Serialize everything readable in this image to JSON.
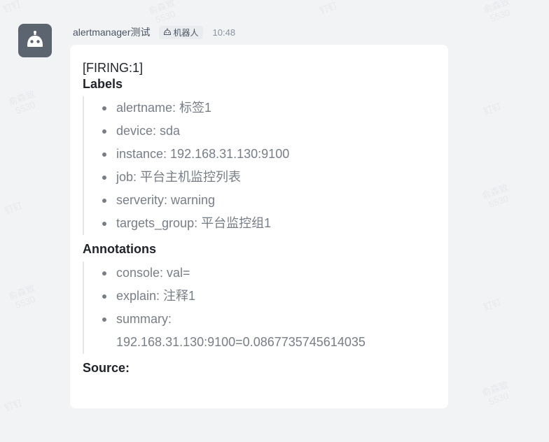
{
  "watermark": {
    "lines": [
      "钉钉",
      "俞森致",
      "5530"
    ]
  },
  "icons": {
    "avatar": "robot-icon",
    "bot_tag": "robot-icon"
  },
  "colors": {
    "background": "#f2f3f5",
    "card": "#ffffff",
    "avatar_bg": "#5c6470",
    "item_text": "#787e87"
  },
  "header": {
    "sender": "alertmanager测试",
    "bot_tag": "机器人",
    "time": "10:48"
  },
  "message": {
    "firing": "[FIRING:1]",
    "labels_title": "Labels",
    "labels": [
      "alertname: 标签1",
      "device: sda",
      "instance: 192.168.31.130:9100",
      "job: 平台主机监控列表",
      "serverity: warning",
      "targets_group: 平台监控组1"
    ],
    "annotations_title": "Annotations",
    "annotations": [
      "console: val=",
      "explain: 注释1",
      "summary:",
      "192.168.31.130:9100=0.0867735745614035"
    ],
    "source": "Source:"
  }
}
